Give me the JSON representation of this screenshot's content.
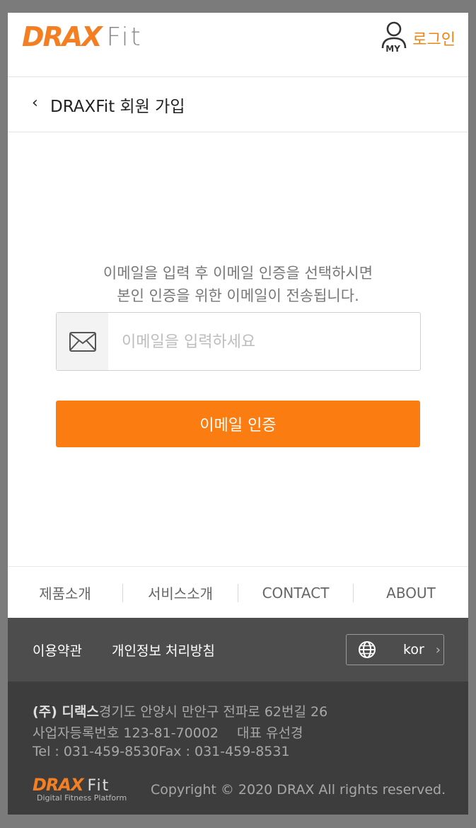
{
  "header": {
    "logo_drax": "DRAX",
    "logo_fit": "Fit",
    "my_label": "MY",
    "login_label": "로그인"
  },
  "titlebar": {
    "back_icon": "chevron-left-icon",
    "back_glyph": "‹",
    "title": "DRAXFit 회원 가입"
  },
  "main": {
    "description_line1": "이메일을 입력 후 이메일 인증을 선택하시면",
    "description_line2": "본인 인증을 위한 이메일이 전송됩니다.",
    "email_icon": "envelope-icon",
    "email_placeholder": "이메일을 입력하세요",
    "email_value": "",
    "verify_button": "이메일 인증"
  },
  "footer_nav": [
    "제품소개",
    "서비스소개",
    "CONTACT",
    "ABOUT"
  ],
  "legal": {
    "terms": "이용약관",
    "privacy": "개인정보 처리방침",
    "lang_icon": "globe-icon",
    "lang_code": "kor",
    "lang_chevron": "›"
  },
  "company": {
    "name": "(주) 디랙스",
    "address": "경기도 안양시 만안구 전파로 62번길 26",
    "business_no": "사업자등록번호 123-81-70002",
    "ceo": "대표 유선경",
    "tel": "Tel : 031-459-8530",
    "fax": "Fax : 031-459-8531",
    "logo_drax": "DRAX",
    "logo_fit": "Fit",
    "logo_tagline": "Digital Fitness Platform",
    "copyright": "Copyright © 2020 DRAX All rights reserved."
  },
  "colors": {
    "accent": "#fb7d11",
    "login_text": "#f08314",
    "legal_bg": "#4d4d4d",
    "company_bg": "#3d3d3d",
    "outer_bg": "#7b7b7b"
  }
}
